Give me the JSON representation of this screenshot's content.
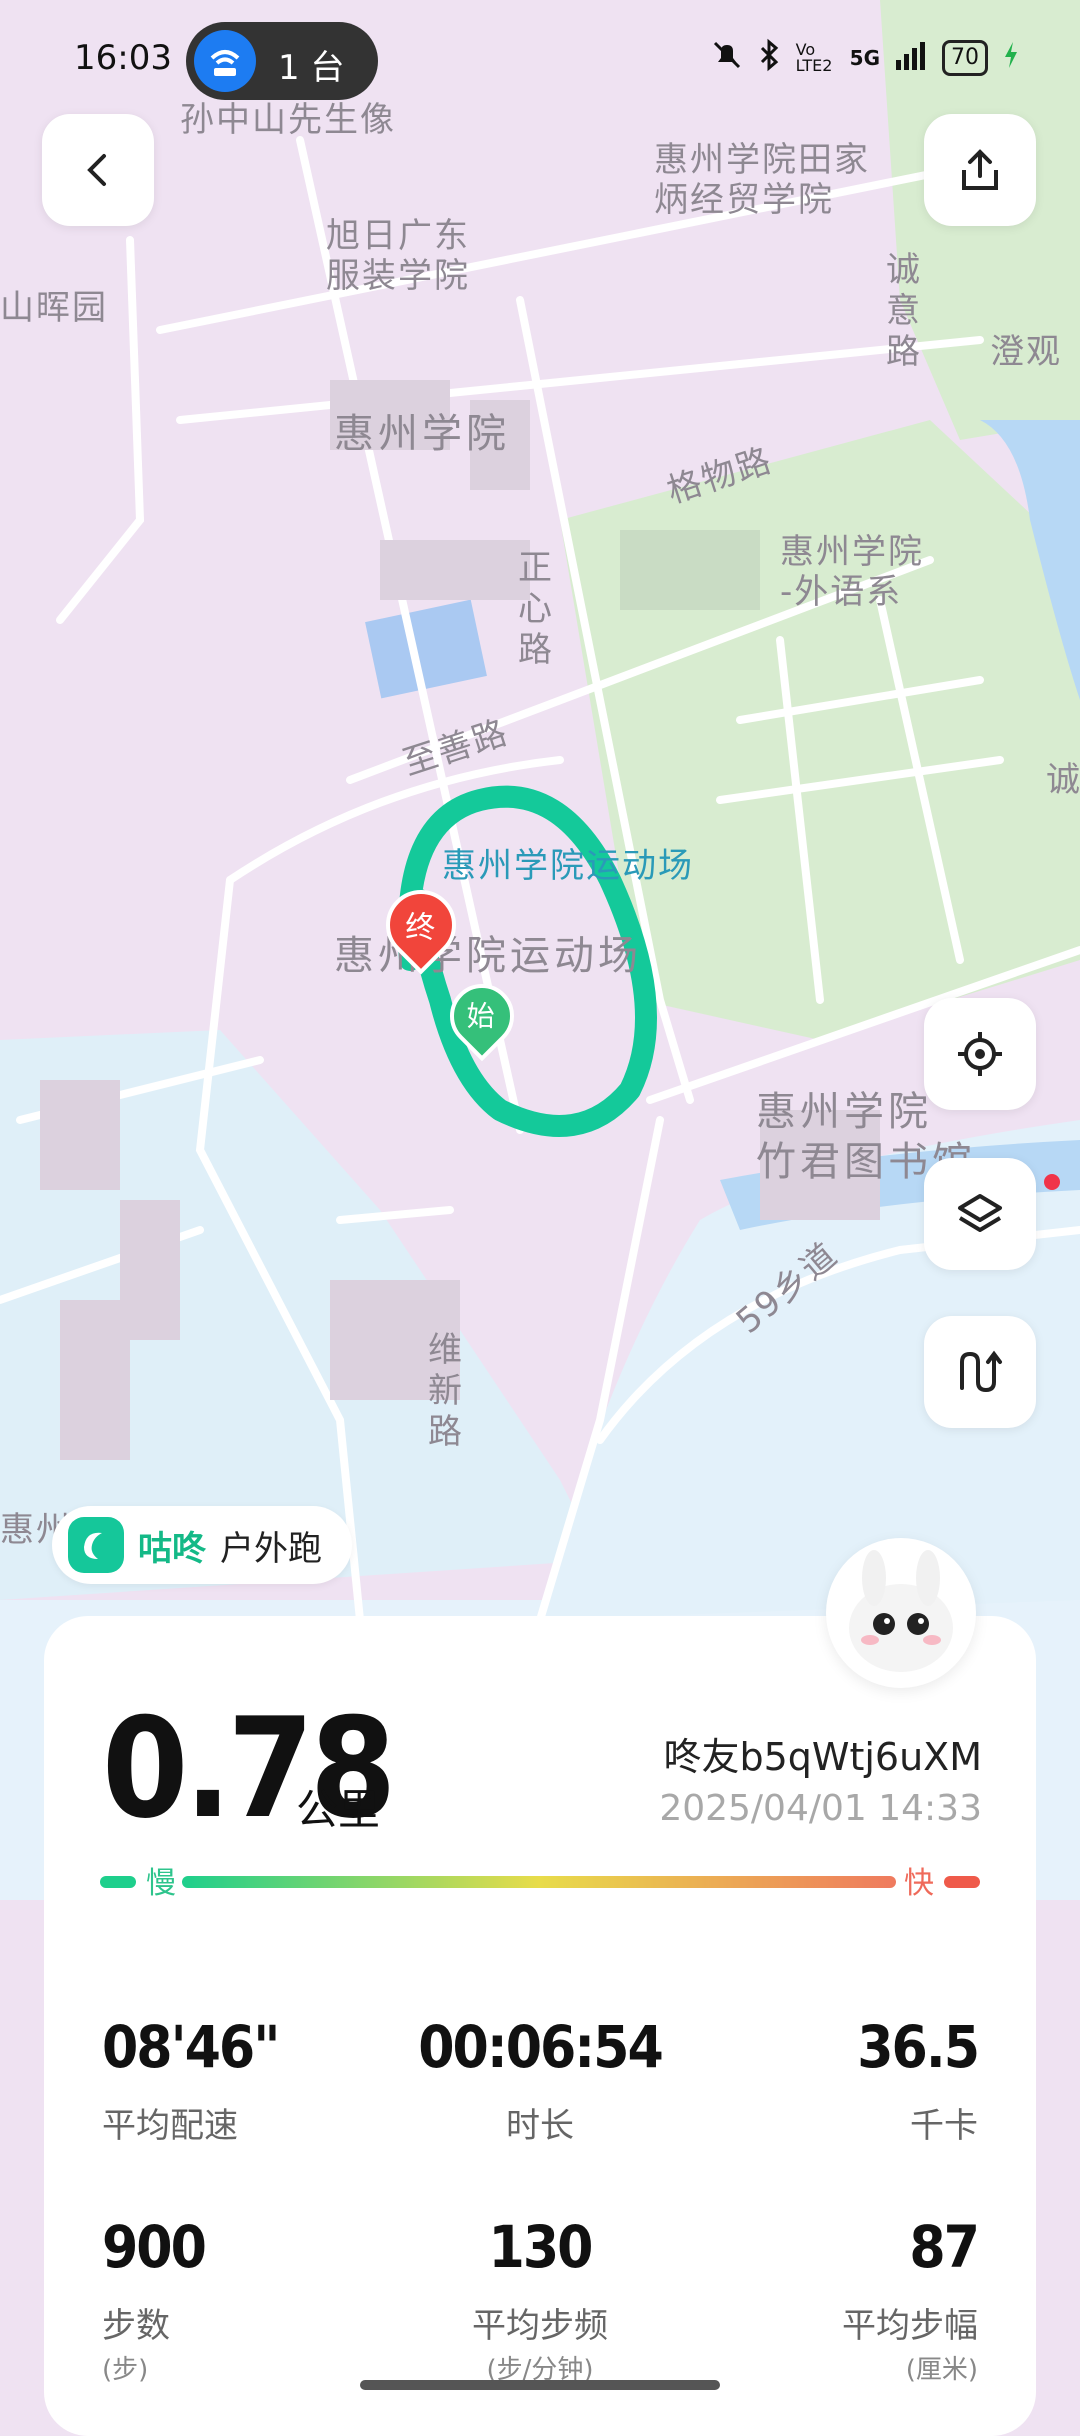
{
  "status_bar": {
    "time": "16:03",
    "hotspot_count": "1 台",
    "network": "5G",
    "volte": "Vo LTE2",
    "battery": "70"
  },
  "map": {
    "labels": {
      "sun_zhongshan": "孙中山先生像",
      "huizhou_tianjia": "惠州学院田家",
      "huizhou_tianjia2": "炳经贸学院",
      "xuri": "旭日广东",
      "xuri2": "服装学院",
      "shanhui": "山晖园",
      "chengyi_road": "诚意路",
      "chengguan": "澄观",
      "huizhou_univ": "惠州学院",
      "gewu_road": "格物路",
      "zhengxin_road": "正心路",
      "waiyu": "惠州学院",
      "waiyu2": "-外语系",
      "zhishan_road": "至善路",
      "stadium_poi": "惠州学院运动场",
      "stadium_area": "惠州学院运动场",
      "library": "惠州学院",
      "library2": "竹君图书馆",
      "xiangdao": "59乡道",
      "weixin_road": "维新路",
      "hui_edge": "惠州",
      "cheng_edge": "诚"
    },
    "markers": {
      "end": "终",
      "start": "始"
    },
    "route_color": "#14c99a"
  },
  "badge": {
    "brand": "咕咚",
    "mode": "户外跑"
  },
  "summary": {
    "distance": "0.78",
    "distance_unit": "公里",
    "user": "咚友b5qWtj6uXM",
    "datetime": "2025/04/01 14:33",
    "pace_slow": "慢",
    "pace_fast": "快"
  },
  "stats": [
    {
      "value": "08'46\"",
      "label": "平均配速"
    },
    {
      "value": "00:06:54",
      "label": "时长"
    },
    {
      "value": "36.5",
      "label": "千卡"
    },
    {
      "value": "900",
      "label": "步数",
      "unit": "(步)"
    },
    {
      "value": "130",
      "label": "平均步频",
      "unit": "(步/分钟)"
    },
    {
      "value": "87",
      "label": "平均步幅",
      "unit": "(厘米)"
    }
  ]
}
